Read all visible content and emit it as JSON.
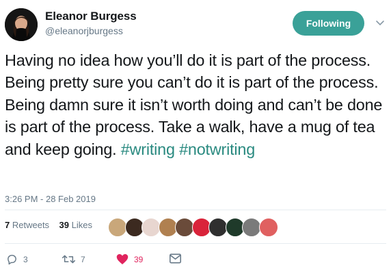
{
  "author": {
    "name": "Eleanor Burgess",
    "handle": "@eleanorjburgess"
  },
  "follow_button": {
    "label": "Following"
  },
  "tweet": {
    "text_segments": [
      "Having no idea how you’ll do it is part of the process. Being pretty sure you can’t do it is part of the process. Being damn sure it isn’t worth doing and can’t be done is part of the process. Take a walk, have a mug of tea and keep going. "
    ],
    "hashtags": [
      "#writing",
      "#notwriting"
    ],
    "timestamp": "3:26 PM - 28 Feb 2019"
  },
  "stats": {
    "retweets_count": "7",
    "retweets_label": "Retweets",
    "likes_count": "39",
    "likes_label": "Likes"
  },
  "actions": {
    "reply_count": "3",
    "retweet_count": "7",
    "like_count": "39"
  },
  "icons": {
    "reply": "reply-icon",
    "retweet": "retweet-icon",
    "like": "heart-icon",
    "message": "envelope-icon",
    "caret": "chevron-down-icon"
  },
  "colors": {
    "accent": "#3aa198",
    "hashtag": "#2a8a80",
    "like": "#e0245e",
    "muted": "#657786"
  },
  "likers": [
    {
      "color": "#c9a77a"
    },
    {
      "color": "#3c2a20"
    },
    {
      "color": "#e8d6d0"
    },
    {
      "color": "#b08050"
    },
    {
      "color": "#6a4b3a"
    },
    {
      "color": "#d9233a"
    },
    {
      "color": "#2f2f2f"
    },
    {
      "color": "#1f3a2a"
    },
    {
      "color": "#7a7a7a"
    },
    {
      "color": "#e06060"
    }
  ]
}
